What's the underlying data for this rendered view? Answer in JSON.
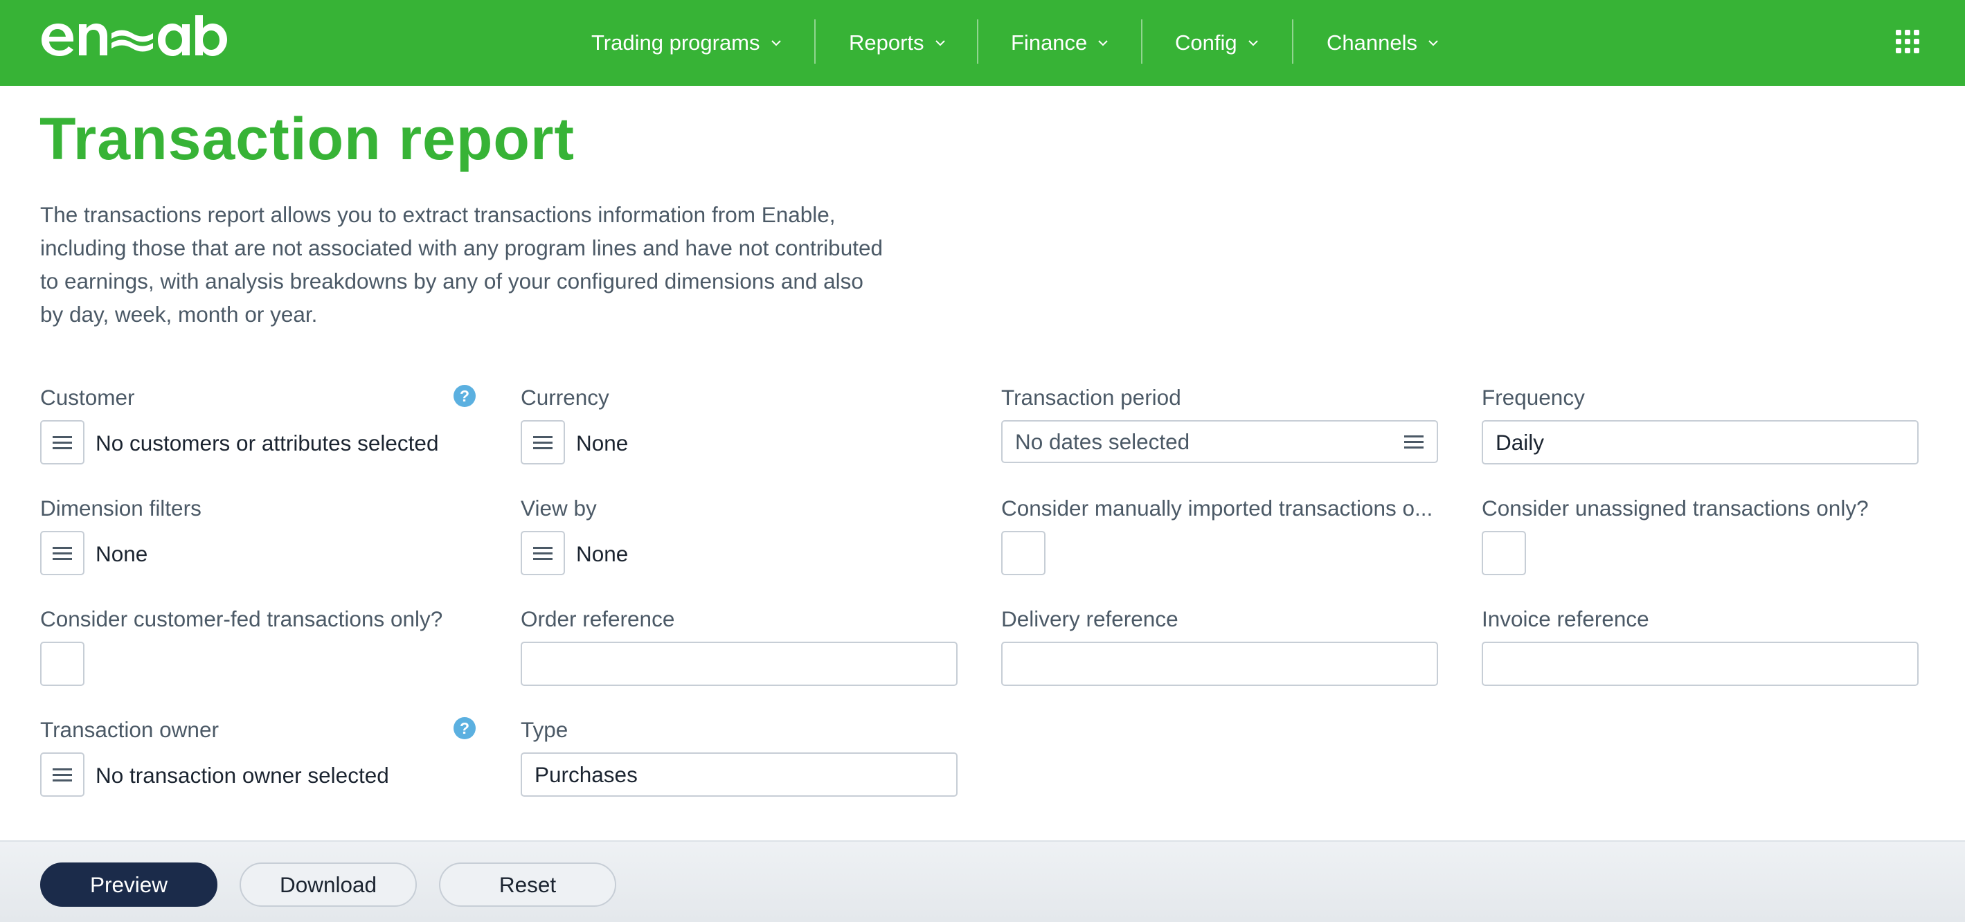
{
  "app": {
    "logo_text": "enable"
  },
  "nav": {
    "items": [
      {
        "label": "Trading programs"
      },
      {
        "label": "Reports"
      },
      {
        "label": "Finance"
      },
      {
        "label": "Config"
      },
      {
        "label": "Channels"
      }
    ],
    "apps_icon": "grid-icon"
  },
  "page": {
    "title": "Transaction report",
    "description": "The transactions report allows you to extract transactions information from Enable, including those that are not associated with any program lines and have not contributed to earnings, with analysis breakdowns by any of your configured dimensions and also by day, week, month or year."
  },
  "form": {
    "customer": {
      "label": "Customer",
      "value": "No customers or attributes selected"
    },
    "currency": {
      "label": "Currency",
      "value": "None"
    },
    "transaction_period": {
      "label": "Transaction period",
      "placeholder": "No dates selected"
    },
    "frequency": {
      "label": "Frequency",
      "value": "Daily"
    },
    "dimension_filters": {
      "label": "Dimension filters",
      "value": "None"
    },
    "view_by": {
      "label": "View by",
      "value": "None"
    },
    "manually_imported": {
      "label": "Consider manually imported transactions o...",
      "checked": false
    },
    "unassigned": {
      "label": "Consider unassigned transactions only?",
      "checked": false
    },
    "customer_fed": {
      "label": "Consider customer-fed transactions only?",
      "checked": false
    },
    "order_reference": {
      "label": "Order reference",
      "value": ""
    },
    "delivery_reference": {
      "label": "Delivery reference",
      "value": ""
    },
    "invoice_reference": {
      "label": "Invoice reference",
      "value": ""
    },
    "transaction_owner": {
      "label": "Transaction owner",
      "value": "No transaction owner selected"
    },
    "type": {
      "label": "Type",
      "value": "Purchases"
    }
  },
  "footer": {
    "preview_label": "Preview",
    "download_label": "Download",
    "reset_label": "Reset"
  },
  "colors": {
    "brand_green": "#37b336",
    "primary_button": "#1b2b4a",
    "help_blue": "#5bb0e0"
  }
}
